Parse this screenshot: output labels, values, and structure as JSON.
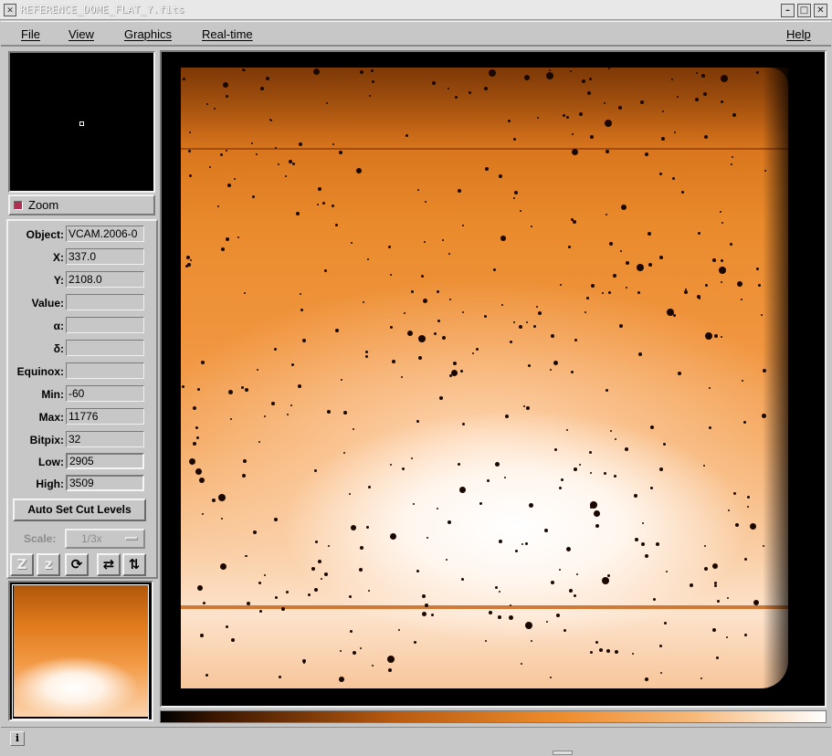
{
  "window": {
    "title": "REFERENCE_DOME_FLAT_Y.fits",
    "icon_glyph": "✕",
    "min_glyph": "–",
    "max_glyph": "□",
    "close_glyph": "✕"
  },
  "menubar": {
    "file": "File",
    "view": "View",
    "graphics": "Graphics",
    "realtime": "Real-time",
    "help": "Help"
  },
  "zoom": {
    "label": "Zoom",
    "checked": true
  },
  "info": {
    "object_label": "Object:",
    "object_value": "VCAM.2006-0",
    "x_label": "X:",
    "x_value": "337.0",
    "y_label": "Y:",
    "y_value": "2108.0",
    "value_label": "Value:",
    "value_value": "",
    "alpha_label": "α:",
    "alpha_value": "",
    "delta_label": "δ:",
    "delta_value": "",
    "equinox_label": "Equinox:",
    "equinox_value": "",
    "min_label": "Min:",
    "min_value": "-60",
    "max_label": "Max:",
    "max_value": "11776",
    "bitpix_label": "Bitpix:",
    "bitpix_value": "32",
    "low_label": "Low:",
    "low_value": "2905",
    "high_label": "High:",
    "high_value": "3509"
  },
  "controls": {
    "auto_cut_label": "Auto Set Cut Levels",
    "scale_label": "Scale:",
    "scale_value": "1/3x",
    "tool_zoom_in": "Z",
    "tool_zoom_out": "z",
    "tool_rotate": "⟳",
    "tool_flip_x": "⇄",
    "tool_flip_y": "⇅"
  },
  "status": {
    "info_icon": "i",
    "message": ""
  },
  "colors": {
    "panel_bg": "#c7c7c7",
    "image_orange": "#e98a2c",
    "zoom_check": "#b03050"
  }
}
